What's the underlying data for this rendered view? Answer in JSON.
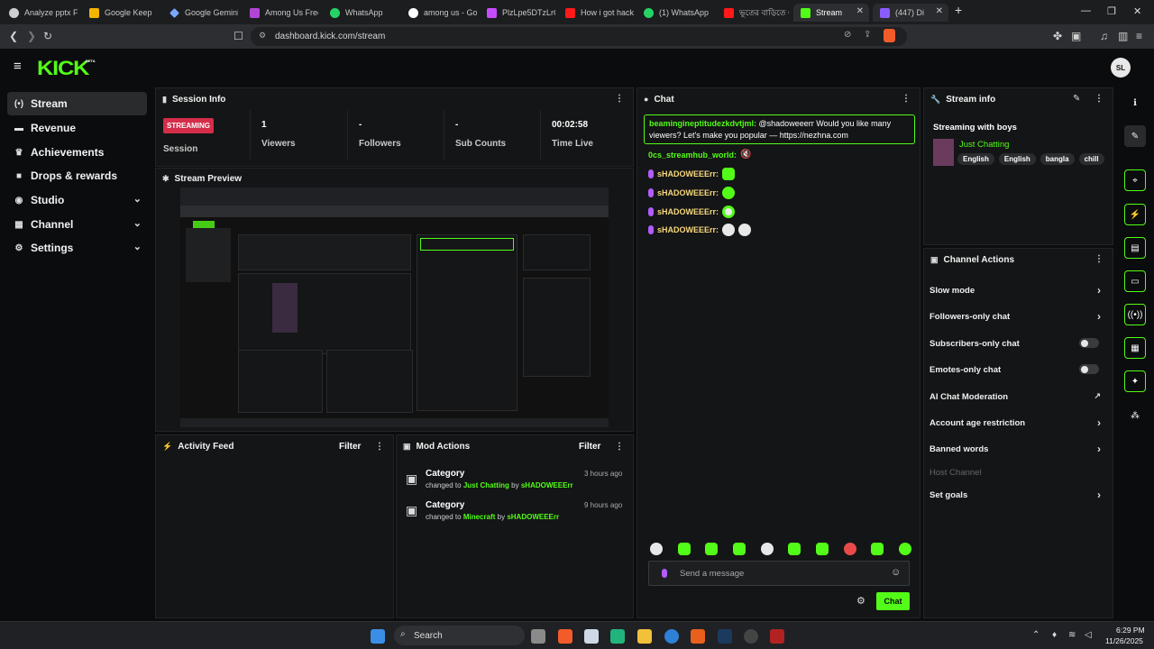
{
  "browser": {
    "tabs": [
      {
        "label": "Analyze pptx Fi",
        "color": "#cfcfcf"
      },
      {
        "label": "Google Keep",
        "color": "#f4b400"
      },
      {
        "label": "Google Gemini",
        "color": "#7aa7ff"
      },
      {
        "label": "Among Us Free",
        "color": "#b146d6"
      },
      {
        "label": "WhatsApp",
        "color": "#25d366"
      },
      {
        "label": "among us - Go",
        "color": "#ffffff"
      },
      {
        "label": "PlzLpe5DTzLrQ",
        "color": "#c84cff"
      },
      {
        "label": "How i got hack",
        "color": "#ff1a1a"
      },
      {
        "label": "(1) WhatsApp",
        "color": "#25d366"
      },
      {
        "label": "ভূতের বাড়িতে এ",
        "color": "#ff1a1a"
      },
      {
        "label": "Stream",
        "color": "#53fc18"
      },
      {
        "label": "(447) Di",
        "color": "#8a5cff"
      }
    ],
    "url": "dashboard.kick.com/stream"
  },
  "header": {
    "logo": "KICK",
    "beta": "BETA",
    "avatar_initials": "SL"
  },
  "sidebar": {
    "items": [
      {
        "label": "Stream",
        "icon": "stream-icon"
      },
      {
        "label": "Revenue",
        "icon": "revenue-icon"
      },
      {
        "label": "Achievements",
        "icon": "trophy-icon"
      },
      {
        "label": "Drops & rewards",
        "icon": "gift-icon"
      },
      {
        "label": "Studio",
        "icon": "studio-icon"
      },
      {
        "label": "Channel",
        "icon": "channel-icon"
      },
      {
        "label": "Settings",
        "icon": "gear-icon"
      }
    ]
  },
  "session_info": {
    "title": "Session Info",
    "badge": "STREAMING",
    "badge_label": "Session",
    "stats": [
      {
        "value": "1",
        "label": "Viewers"
      },
      {
        "value": "-",
        "label": "Followers"
      },
      {
        "value": "-",
        "label": "Sub Counts"
      },
      {
        "value": "00:02:58",
        "label": "Time Live"
      }
    ]
  },
  "stream_preview": {
    "title": "Stream Preview"
  },
  "activity_feed": {
    "title": "Activity Feed",
    "filter": "Filter"
  },
  "mod_actions": {
    "title": "Mod Actions",
    "filter": "Filter",
    "items": [
      {
        "title": "Category",
        "prefix": "changed to",
        "target": "Just Chatting",
        "by": "by",
        "user": "sHADOWEEErr",
        "time": "3 hours ago"
      },
      {
        "title": "Category",
        "prefix": "changed to",
        "target": "Minecraft",
        "by": "by",
        "user": "sHADOWEEErr",
        "time": "9 hours ago"
      }
    ]
  },
  "chat": {
    "title": "Chat",
    "highlight": {
      "user": "beamingineptitudezkdvtjml:",
      "text": "@shadoweeerr Would you like many viewers? Let's make you popular — https://nezhna.com"
    },
    "system_user": "0cs_streamhub_world:",
    "messages": [
      {
        "user": "sHADOWEEErr:",
        "emote_color": "#53fc18"
      },
      {
        "user": "sHADOWEEErr:",
        "emote_color": "#53fc18"
      },
      {
        "user": "sHADOWEEErr:",
        "emote_color": "#e8e8e8"
      },
      {
        "user": "sHADOWEEErr:",
        "emote_color": "#e8e8e8"
      }
    ],
    "emote_bar": [
      "#e8e8e8",
      "#53fc18",
      "#53fc18",
      "#53fc18",
      "#e8e8e8",
      "#53fc18",
      "#53fc18",
      "#e84a4a",
      "#53fc18",
      "#53fc18"
    ],
    "input_placeholder": "Send a message",
    "send_label": "Chat"
  },
  "stream_info": {
    "title": "Stream info",
    "stream_title": "Streaming with boys",
    "category": "Just Chatting",
    "tags": [
      "English",
      "English",
      "bangla",
      "chill"
    ]
  },
  "channel_actions": {
    "title": "Channel Actions",
    "rows": [
      {
        "label": "Slow mode",
        "kind": "arrow"
      },
      {
        "label": "Followers-only chat",
        "kind": "arrow"
      },
      {
        "label": "Subscribers-only chat",
        "kind": "toggle"
      },
      {
        "label": "Emotes-only chat",
        "kind": "toggle"
      },
      {
        "label": "AI Chat Moderation",
        "kind": "external"
      },
      {
        "label": "Account age restriction",
        "kind": "arrow"
      },
      {
        "label": "Banned words",
        "kind": "arrow"
      },
      {
        "label": "Host Channel",
        "kind": "disabled"
      },
      {
        "label": "Set goals",
        "kind": "arrow"
      }
    ]
  },
  "taskbar": {
    "search": "Search",
    "time": "6:29 PM",
    "date": "11/26/2025"
  },
  "colors": {
    "accent": "#53fc18",
    "streaming": "#d42d4a",
    "panel": "#141516"
  }
}
